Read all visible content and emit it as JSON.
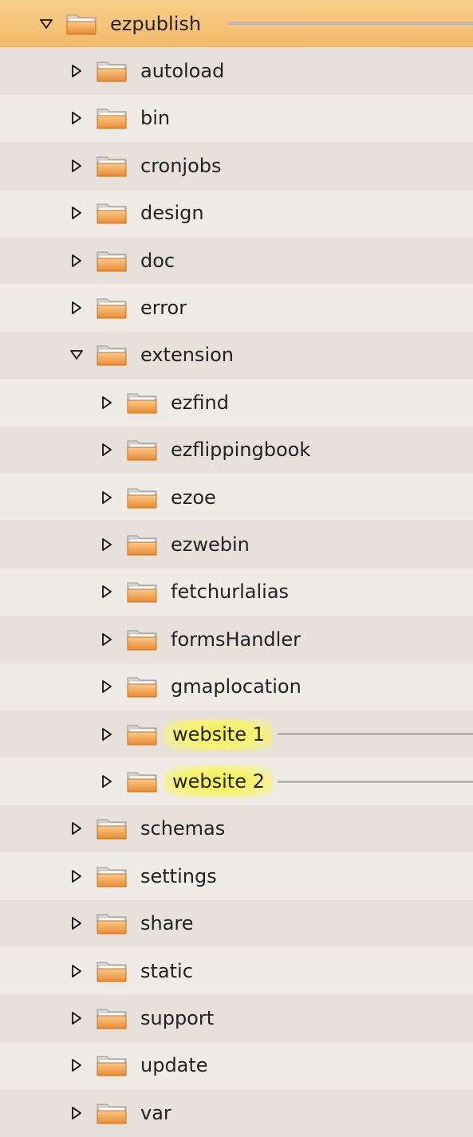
{
  "tree": {
    "root": "ezpublish",
    "rows": [
      {
        "label": "ezpublish",
        "depth": 0,
        "expanded": true,
        "selected": true,
        "highlight": false,
        "pointer_line": true
      },
      {
        "label": "autoload",
        "depth": 1,
        "expanded": false,
        "selected": false,
        "highlight": false,
        "pointer_line": false
      },
      {
        "label": "bin",
        "depth": 1,
        "expanded": false,
        "selected": false,
        "highlight": false,
        "pointer_line": false
      },
      {
        "label": "cronjobs",
        "depth": 1,
        "expanded": false,
        "selected": false,
        "highlight": false,
        "pointer_line": false
      },
      {
        "label": "design",
        "depth": 1,
        "expanded": false,
        "selected": false,
        "highlight": false,
        "pointer_line": false
      },
      {
        "label": "doc",
        "depth": 1,
        "expanded": false,
        "selected": false,
        "highlight": false,
        "pointer_line": false
      },
      {
        "label": "error",
        "depth": 1,
        "expanded": false,
        "selected": false,
        "highlight": false,
        "pointer_line": false
      },
      {
        "label": "extension",
        "depth": 1,
        "expanded": true,
        "selected": false,
        "highlight": false,
        "pointer_line": false
      },
      {
        "label": "ezfind",
        "depth": 2,
        "expanded": false,
        "selected": false,
        "highlight": false,
        "pointer_line": false
      },
      {
        "label": "ezflippingbook",
        "depth": 2,
        "expanded": false,
        "selected": false,
        "highlight": false,
        "pointer_line": false
      },
      {
        "label": "ezoe",
        "depth": 2,
        "expanded": false,
        "selected": false,
        "highlight": false,
        "pointer_line": false
      },
      {
        "label": "ezwebin",
        "depth": 2,
        "expanded": false,
        "selected": false,
        "highlight": false,
        "pointer_line": false
      },
      {
        "label": "fetchurlalias",
        "depth": 2,
        "expanded": false,
        "selected": false,
        "highlight": false,
        "pointer_line": false
      },
      {
        "label": "formsHandler",
        "depth": 2,
        "expanded": false,
        "selected": false,
        "highlight": false,
        "pointer_line": false
      },
      {
        "label": "gmaplocation",
        "depth": 2,
        "expanded": false,
        "selected": false,
        "highlight": false,
        "pointer_line": false
      },
      {
        "label": "website 1",
        "depth": 2,
        "expanded": false,
        "selected": false,
        "highlight": true,
        "pointer_line": true
      },
      {
        "label": "website 2",
        "depth": 2,
        "expanded": false,
        "selected": false,
        "highlight": true,
        "pointer_line": true
      },
      {
        "label": "schemas",
        "depth": 1,
        "expanded": false,
        "selected": false,
        "highlight": false,
        "pointer_line": false
      },
      {
        "label": "settings",
        "depth": 1,
        "expanded": false,
        "selected": false,
        "highlight": false,
        "pointer_line": false
      },
      {
        "label": "share",
        "depth": 1,
        "expanded": false,
        "selected": false,
        "highlight": false,
        "pointer_line": false
      },
      {
        "label": "static",
        "depth": 1,
        "expanded": false,
        "selected": false,
        "highlight": false,
        "pointer_line": false
      },
      {
        "label": "support",
        "depth": 1,
        "expanded": false,
        "selected": false,
        "highlight": false,
        "pointer_line": false
      },
      {
        "label": "update",
        "depth": 1,
        "expanded": false,
        "selected": false,
        "highlight": false,
        "pointer_line": false
      },
      {
        "label": "var",
        "depth": 1,
        "expanded": false,
        "selected": false,
        "highlight": false,
        "pointer_line": false
      }
    ]
  },
  "icons": {
    "folder": "folder-icon",
    "expanded": "triangle-down-icon",
    "collapsed": "triangle-right-icon"
  },
  "colors": {
    "folder_orange": "#f0a050",
    "selection": "#f4c07a",
    "highlight": "#f7f37a",
    "pointer_line": "#b9b5b0"
  }
}
